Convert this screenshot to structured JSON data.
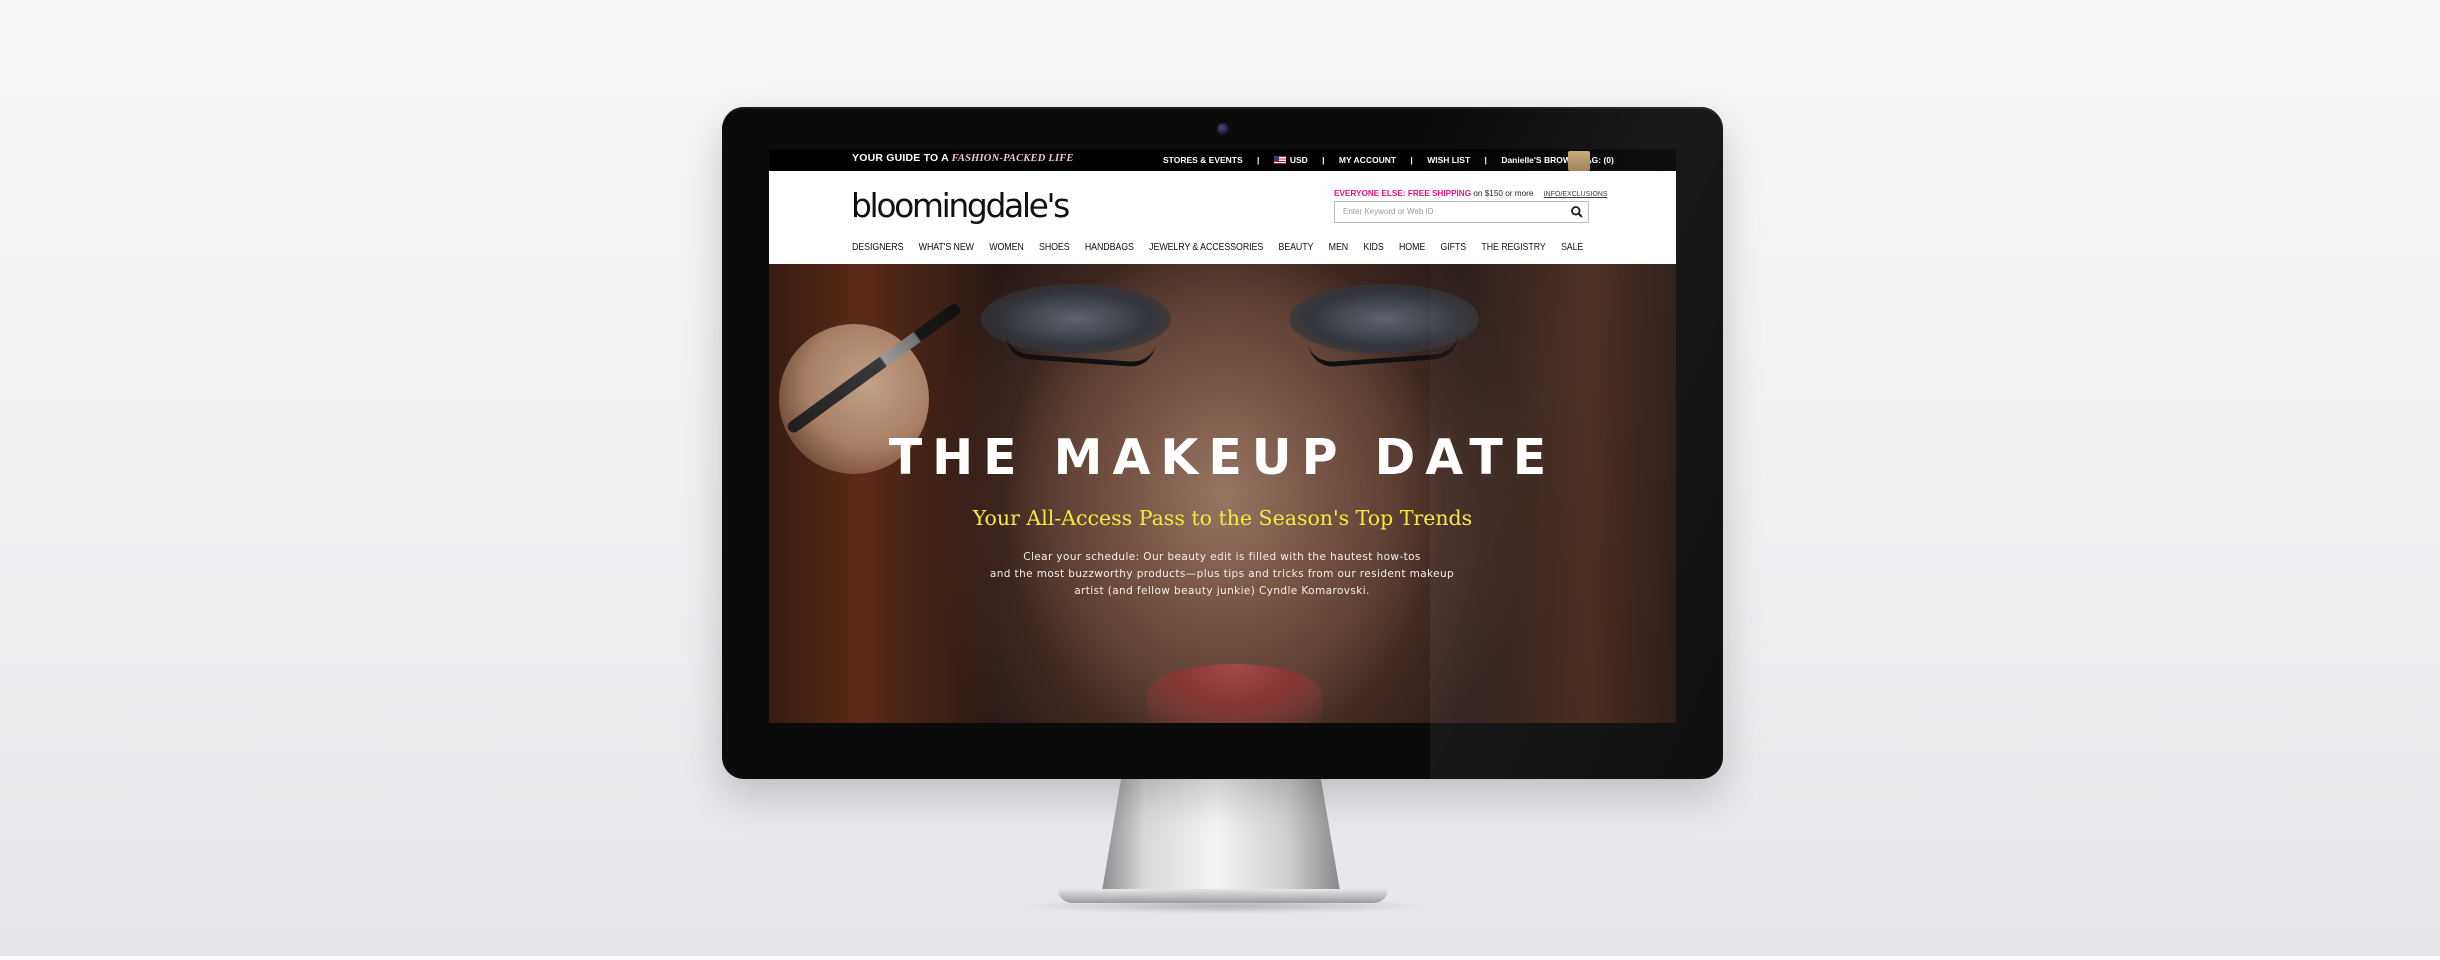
{
  "utility_bar": {
    "tagline_prefix": "YOUR GUIDE TO A",
    "tagline_accent": "FASHION-PACKED LIFE",
    "stores_events": "STORES & EVENTS",
    "currency": "USD",
    "my_account": "MY ACCOUNT",
    "wish_list": "WISH LIST",
    "brown_bag": "Danielle'S BROWN BAG: (0)",
    "separator": "|"
  },
  "header": {
    "logo": "bloomingdale's",
    "promo_strong": "EVERYONE ELSE: FREE SHIPPING",
    "promo_rest": " on $150 or more",
    "promo_link": "INFO/EXCLUSIONS",
    "search_placeholder": "Enter Keyword or Web ID"
  },
  "nav": {
    "items": [
      "DESIGNERS",
      "WHAT'S NEW",
      "WOMEN",
      "SHOES",
      "HANDBAGS",
      "JEWELRY & ACCESSORIES",
      "BEAUTY",
      "MEN",
      "KIDS",
      "HOME",
      "GIFTS",
      "THE REGISTRY",
      "SALE"
    ]
  },
  "hero": {
    "title": "THE MAKEUP DATE",
    "subtitle": "Your All-Access Pass to the Season's Top Trends",
    "body_lines": [
      "Clear your schedule: Our beauty edit is filled with the hautest how-tos",
      "and the most buzzworthy products—plus tips and tricks from our resident makeup",
      "artist (and fellow beauty junkie) Cyndle Komarovski."
    ]
  },
  "colors": {
    "promo_accent": "#e0147f",
    "hero_subtitle": "#f2ea3c",
    "monitor_bezel": "#0b0b0c"
  },
  "icons": [
    "camera-icon",
    "flag-icon",
    "bag-icon",
    "search-icon"
  ]
}
